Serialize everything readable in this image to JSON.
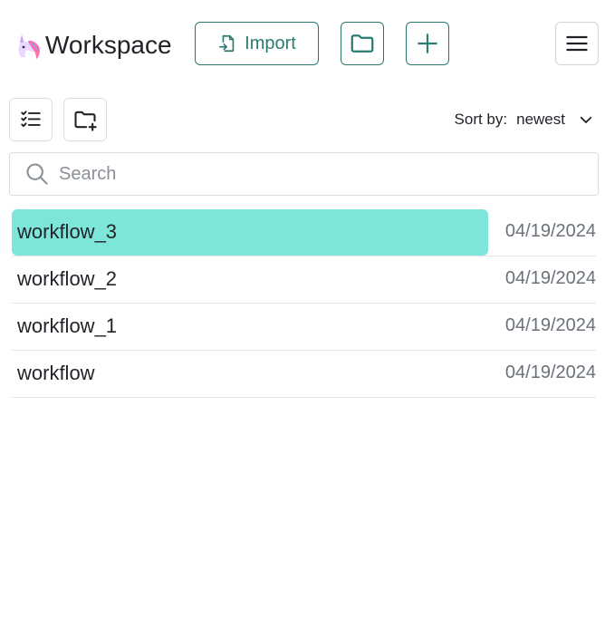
{
  "header": {
    "title": "Workspace",
    "import_label": "Import"
  },
  "sort": {
    "label": "Sort by:",
    "value": "newest"
  },
  "search": {
    "placeholder": "Search"
  },
  "workflows": [
    {
      "name": "workflow_3",
      "date": "04/19/2024",
      "selected": true
    },
    {
      "name": "workflow_2",
      "date": "04/19/2024",
      "selected": false
    },
    {
      "name": "workflow_1",
      "date": "04/19/2024",
      "selected": false
    },
    {
      "name": "workflow",
      "date": "04/19/2024",
      "selected": false
    }
  ],
  "colors": {
    "accent": "#2a7a70",
    "selected_row": "#7ee6d9"
  }
}
